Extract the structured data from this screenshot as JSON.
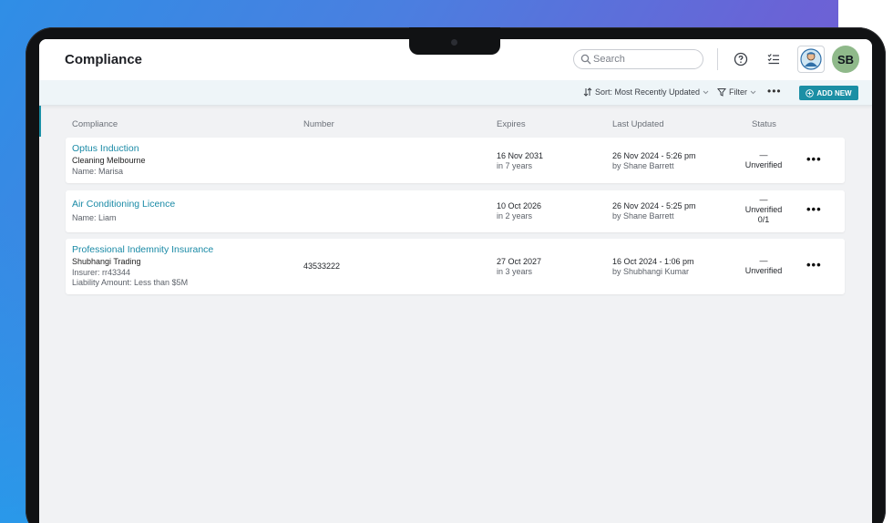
{
  "header": {
    "title": "Compliance",
    "search_placeholder": "Search",
    "avatar_initials": "SB"
  },
  "toolbar": {
    "sort_label": "Sort: Most Recently Updated",
    "filter_label": "Filter",
    "more_label": "•••",
    "add_new_label": "ADD NEW"
  },
  "table": {
    "columns": [
      "Compliance",
      "Number",
      "Expires",
      "Last Updated",
      "Status"
    ],
    "rows": [
      {
        "title": "Optus Induction",
        "lines": [
          "Cleaning Melbourne",
          "Name: Marisa"
        ],
        "number": "",
        "expires": "16 Nov 2031",
        "expires_rel": "in 7 years",
        "updated": "26 Nov 2024 - 5:26 pm",
        "updated_by": "by Shane Barrett",
        "status_dash": "—",
        "status": "Unverified",
        "status_extra": ""
      },
      {
        "title": "Air Conditioning Licence",
        "lines": [
          "Name: Liam"
        ],
        "number": "",
        "expires": "10 Oct 2026",
        "expires_rel": "in 2 years",
        "updated": "26 Nov 2024 - 5:25 pm",
        "updated_by": "by Shane Barrett",
        "status_dash": "—",
        "status": "Unverified",
        "status_extra": "0/1"
      },
      {
        "title": "Professional Indemnity Insurance",
        "lines": [
          "Shubhangi Trading",
          "Insurer: rr43344",
          "Liability Amount: Less than $5M"
        ],
        "number": "43533222",
        "expires": "27 Oct 2027",
        "expires_rel": "in 3 years",
        "updated": "16 Oct 2024 - 1:06 pm",
        "updated_by": "by Shubhangi Kumar",
        "status_dash": "—",
        "status": "Unverified",
        "status_extra": ""
      }
    ],
    "row_menu_label": "•••"
  },
  "colors": {
    "accent": "#1b8fa5",
    "title_link": "#1a8aa6",
    "avatar_bg": "#8fb98a"
  }
}
